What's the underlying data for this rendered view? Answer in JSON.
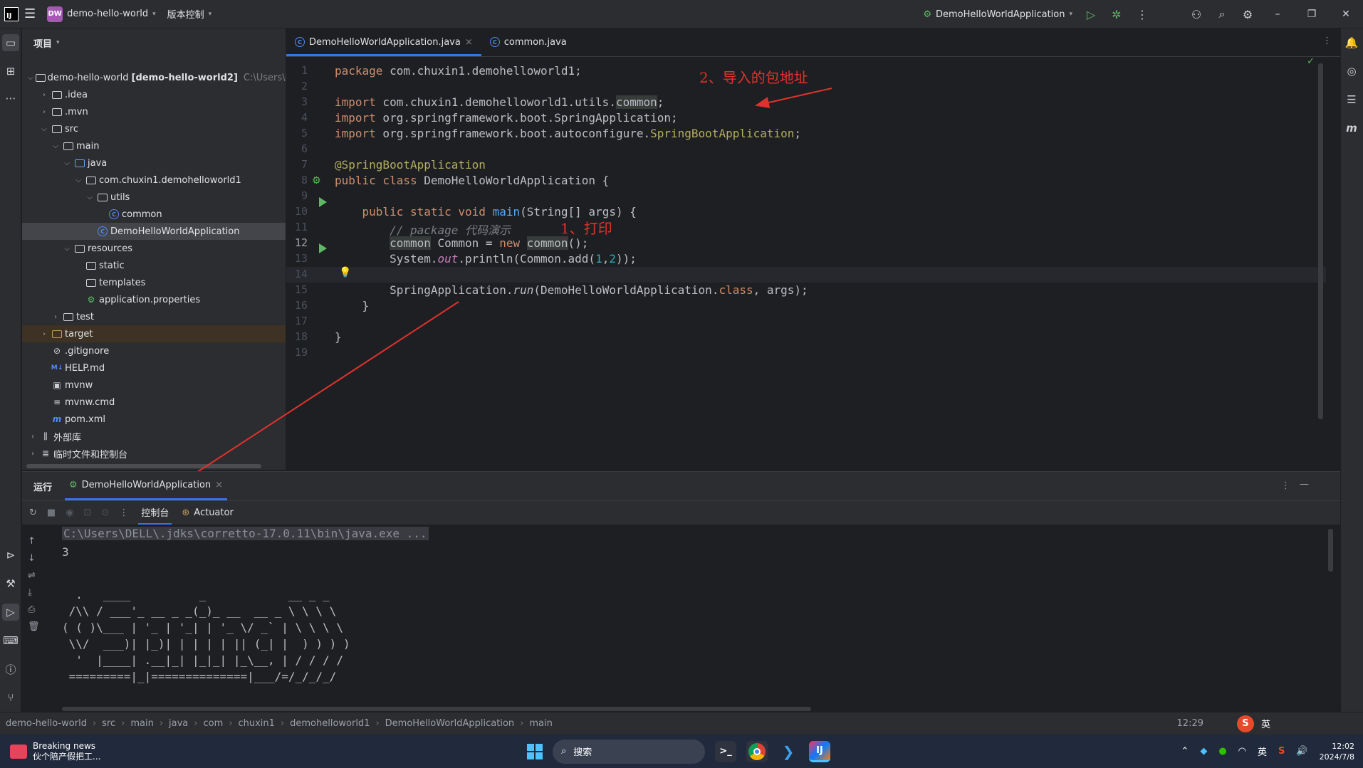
{
  "titlebar": {
    "logo_text": "IJ",
    "project_badge": "DW",
    "project_name": "demo-hello-world",
    "vcs_label": "版本控制",
    "run_config": "DemoHelloWorldApplication"
  },
  "project_panel": {
    "title": "项目",
    "tree": [
      {
        "label": "demo-hello-world",
        "bold_suffix": "[demo-hello-world2]",
        "hint": "C:\\Users\\DELL\\Desktop"
      },
      {
        "label": ".idea"
      },
      {
        "label": ".mvn"
      },
      {
        "label": "src"
      },
      {
        "label": "main"
      },
      {
        "label": "java"
      },
      {
        "label": "com.chuxin1.demohelloworld1"
      },
      {
        "label": "utils"
      },
      {
        "label": "common"
      },
      {
        "label": "DemoHelloWorldApplication"
      },
      {
        "label": "resources"
      },
      {
        "label": "static"
      },
      {
        "label": "templates"
      },
      {
        "label": "application.properties"
      },
      {
        "label": "test"
      },
      {
        "label": "target"
      },
      {
        "label": ".gitignore"
      },
      {
        "label": "HELP.md"
      },
      {
        "label": "mvnw"
      },
      {
        "label": "mvnw.cmd"
      },
      {
        "label": "pom.xml"
      },
      {
        "label": "外部库"
      },
      {
        "label": "临时文件和控制台"
      }
    ]
  },
  "editor": {
    "tabs": [
      {
        "label": "DemoHelloWorldApplication.java",
        "close": "×"
      },
      {
        "label": "common.java"
      }
    ],
    "line_numbers": [
      "1",
      "2",
      "3",
      "4",
      "5",
      "6",
      "7",
      "8",
      "9",
      "10",
      "11",
      "12",
      "13",
      "14",
      "15",
      "16",
      "17",
      "18",
      "19"
    ],
    "current_line": "12",
    "annotations": {
      "note1": "1、打印",
      "note2": "2、导入的包地址"
    }
  },
  "run_panel": {
    "title": "运行",
    "config_tab": "DemoHelloWorldApplication",
    "tabs": [
      "控制台",
      "Actuator"
    ],
    "console": {
      "cmd": "C:\\Users\\DELL\\.jdks\\corretto-17.0.11\\bin\\java.exe ...",
      "output": "3",
      "banner": [
        "  .   ____          _            __ _ _",
        " /\\\\ / ___'_ __ _ _(_)_ __  __ _ \\ \\ \\ \\",
        "( ( )\\___ | '_ | '_| | '_ \\/ _` | \\ \\ \\ \\",
        " \\\\/  ___)| |_)| | | | | || (_| |  ) ) ) )",
        "  '  |____| .__|_| |_|_| |_\\__, | / / / /",
        " =========|_|==============|___/=/_/_/_/"
      ]
    }
  },
  "statusbar": {
    "breadcrumbs": [
      "demo-hello-world",
      "src",
      "main",
      "java",
      "com",
      "chuxin1",
      "demohelloworld1",
      "DemoHelloWorldApplication",
      "main"
    ],
    "position": "12:29"
  },
  "taskbar": {
    "news_title": "Breaking news",
    "news_sub": "伙个陪产假把工...",
    "search_placeholder": "搜索",
    "ime": "英",
    "time": "12:02",
    "date": "2024/7/8"
  }
}
